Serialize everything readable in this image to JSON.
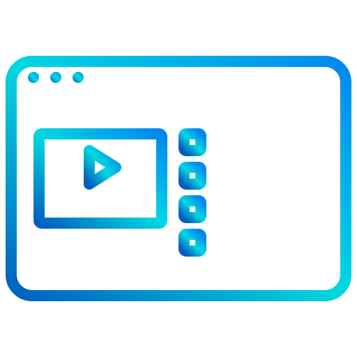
{
  "icon": {
    "name": "video-playlist-browser-icon",
    "gradient": {
      "start": "#0060c0",
      "mid": "#00d8e0",
      "end": "#0088f0"
    },
    "playlist": {
      "items": [
        {
          "name": "playlist-item-1"
        },
        {
          "name": "playlist-item-2"
        },
        {
          "name": "playlist-item-3"
        },
        {
          "name": "playlist-item-4"
        }
      ]
    }
  }
}
